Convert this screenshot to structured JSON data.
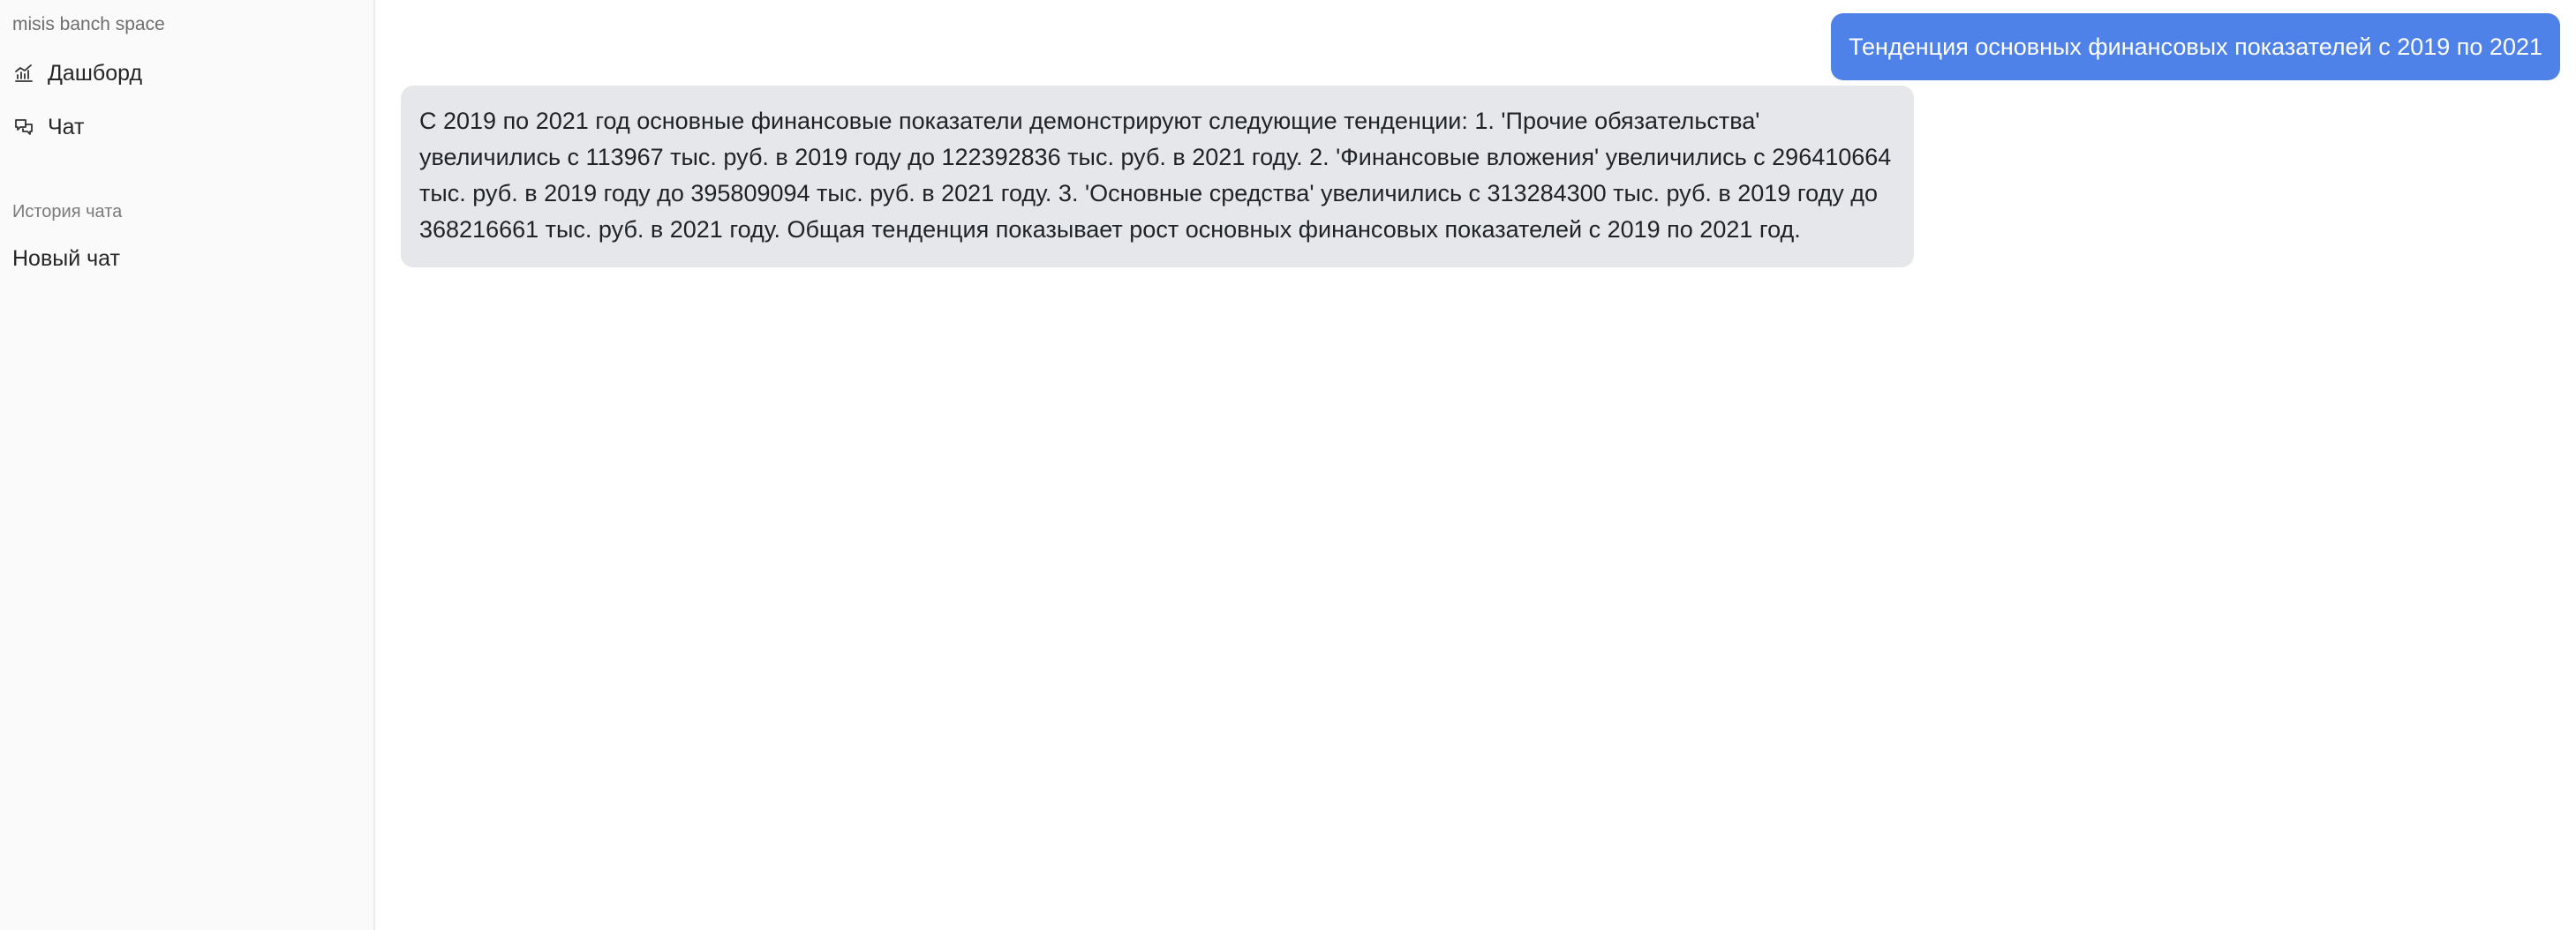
{
  "sidebar": {
    "workspace_name": "misis banch space",
    "nav": [
      {
        "label": "Дашборд",
        "icon": "bar-chart-icon"
      },
      {
        "label": "Чат",
        "icon": "chat-bubbles-icon"
      }
    ],
    "history_title": "История чата",
    "history_items": [
      {
        "label": "Новый чат"
      }
    ]
  },
  "chat": {
    "messages": [
      {
        "role": "user",
        "text": "Тенденция основных финансовых показателей с 2019 по 2021"
      },
      {
        "role": "assistant",
        "text": "С 2019 по 2021 год основные финансовые показатели демонстрируют следующие тенденции: 1. 'Прочие обязательства' увеличились с 113967 тыс. руб. в 2019 году до 122392836 тыс. руб. в 2021 году. 2. 'Финансовые вложения' увеличились с 296410664 тыс. руб. в 2019 году до 395809094 тыс. руб. в 2021 году. 3. 'Основные средства' увеличились с 313284300 тыс. руб. в 2019 году до 368216661 тыс. руб. в 2021 году. Общая тенденция показывает рост основных финансовых показателей с 2019 по 2021 год."
      }
    ]
  },
  "colors": {
    "user_bubble": "#4f82e8",
    "assistant_bubble": "#e5e7ea",
    "sidebar_bg": "#fafafa"
  }
}
